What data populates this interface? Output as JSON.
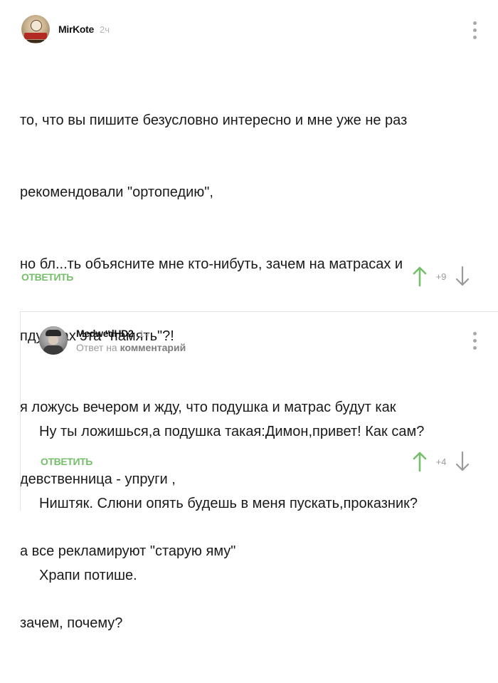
{
  "comment": {
    "author": "MirKote",
    "time": "2ч",
    "text_lines": [
      "то, что вы пишите безусловно интересно и мне уже не раз",
      "рекомендовали \"ортопедию\",",
      "но бл...ть объясните мне кто-нибуть, зачем на матрасах и",
      "пдушках эта \"память\"?!",
      "я ложусь вечером и жду, что подушка и матрас будут как",
      "девственница - упруги ,",
      "а все рекламируют \"старую яму\"",
      "зачем, почему?"
    ],
    "reply_label": "ОТВЕТИТЬ",
    "score": "+9"
  },
  "reply": {
    "author": "MedwedHD2",
    "time": "1ч",
    "meta_prefix": "Ответ на",
    "meta_link": "комментарий",
    "text_lines": [
      "Ну ты ложишься,а подушка такая:Димон,привет! Как сам?",
      "Ништяк. Слюни опять будешь в меня пускать,проказник?",
      "Храпи потише."
    ],
    "reply_label": "ОТВЕТИТЬ",
    "score": "+4"
  },
  "icons": {
    "more": "more-vertical-icon",
    "upvote": "arrow-up-icon",
    "downvote": "arrow-down-icon"
  },
  "colors": {
    "accent_green": "#75bf6a",
    "muted_gray": "#9a9a9a"
  }
}
